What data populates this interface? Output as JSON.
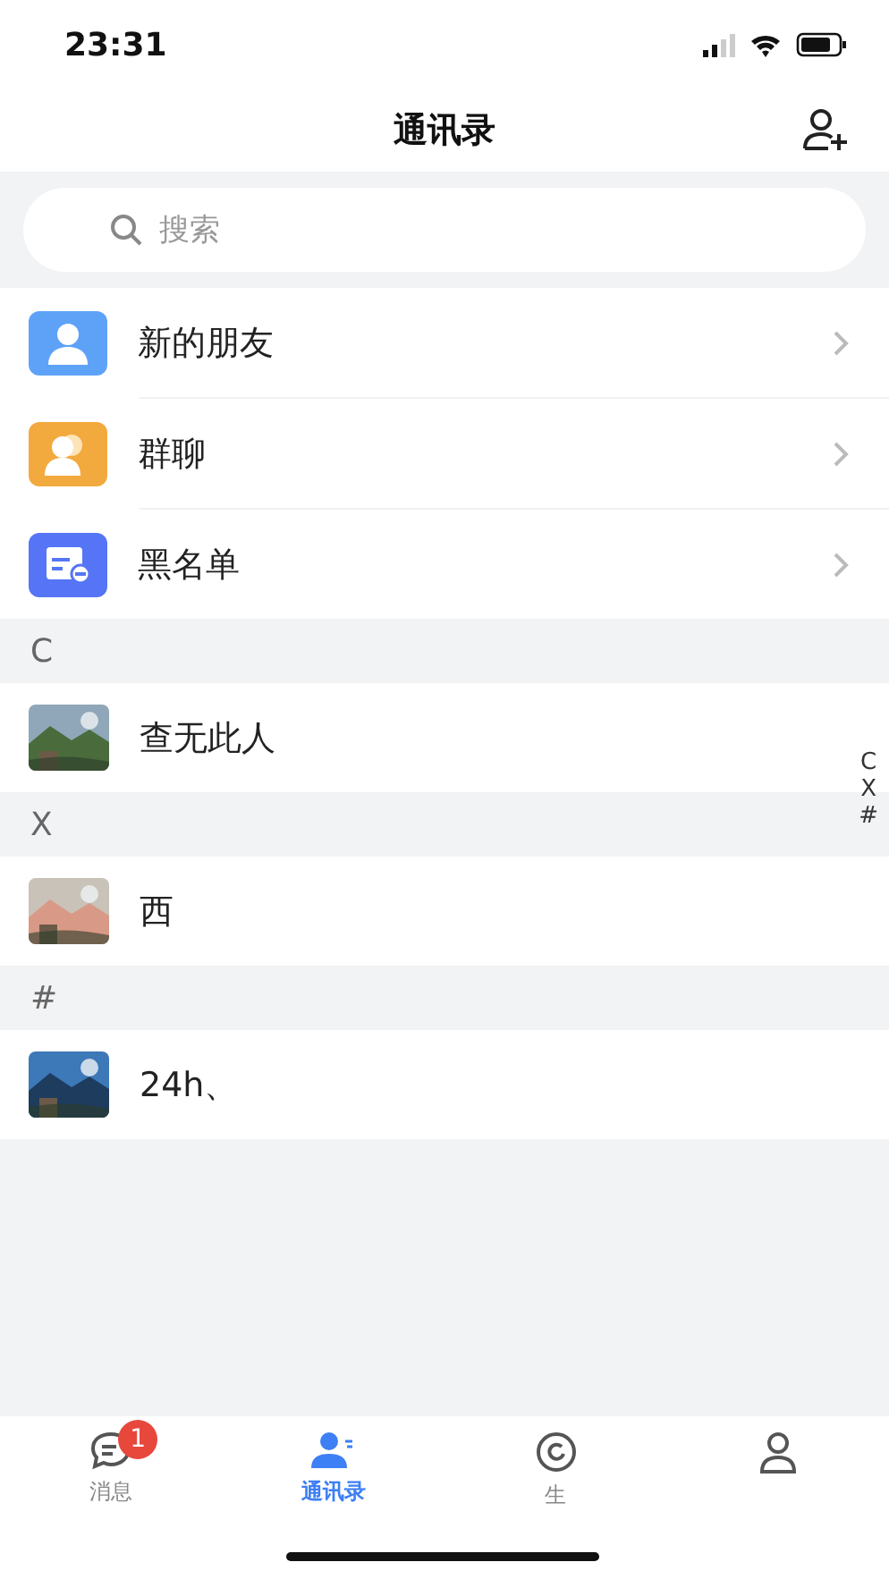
{
  "status_bar": {
    "time": "23:31"
  },
  "header": {
    "title": "通讯录"
  },
  "search": {
    "placeholder": "搜索"
  },
  "entries": [
    {
      "kind": "friend",
      "label": "新的朋友",
      "color": "#5ea2f8"
    },
    {
      "kind": "group",
      "label": "群聊",
      "color": "#f2aa3e"
    },
    {
      "kind": "blacklist",
      "label": "黑名单",
      "color": "#5575f6"
    }
  ],
  "sections": [
    {
      "letter": "C",
      "contacts": [
        {
          "name": "查无此人"
        }
      ]
    },
    {
      "letter": "X",
      "contacts": [
        {
          "name": "西"
        }
      ]
    },
    {
      "letter": "#",
      "contacts": [
        {
          "name": "24h、"
        }
      ]
    }
  ],
  "index_bar": [
    "C",
    "X",
    "#"
  ],
  "tab_bar": [
    {
      "kind": "messages",
      "label": "消息",
      "badge": "1",
      "selected": false
    },
    {
      "kind": "contacts",
      "label": "通讯录",
      "selected": true
    },
    {
      "kind": "life",
      "label": "生",
      "selected": false
    },
    {
      "kind": "profile",
      "selected": false
    }
  ]
}
